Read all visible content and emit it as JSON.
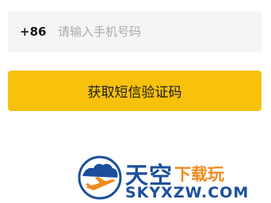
{
  "login": {
    "country_code": "+86",
    "phone_placeholder": "请输入手机号码",
    "phone_value": "",
    "sms_button_label": "获取短信验证码"
  },
  "colors": {
    "accent": "#f7c10c",
    "field_background": "#f5f5f5"
  },
  "watermark": {
    "title": "天空",
    "subtitle": "下载玩",
    "url": "SKYXZW.COM",
    "logo_icon": "airplane-cloud-logo"
  }
}
